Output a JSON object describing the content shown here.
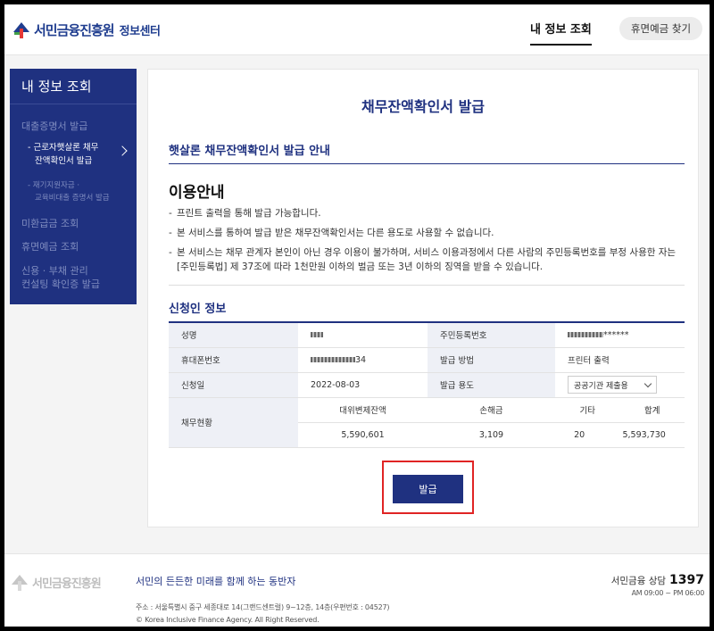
{
  "header": {
    "logo_text": "서민금융진흥원",
    "logo_sub": "정보센터",
    "nav_active": "내 정보 조회",
    "dormant_button": "휴면예금 찾기"
  },
  "sidebar": {
    "title": "내 정보 조회",
    "items": [
      {
        "label": "대출증명서 발급"
      },
      {
        "label": "미환급금 조회"
      },
      {
        "label": "휴면예금 조회"
      },
      {
        "label": "신용 · 부채 관리"
      },
      {
        "label": "컨설팅 확인증 발급"
      }
    ],
    "sub_active_1": "- 근로자햇살론 채무",
    "sub_active_2": "잔액확인서 발급",
    "sub_2_1": "- 재기지원자금 ·",
    "sub_2_2": "교육비대출 증명서 발급"
  },
  "main": {
    "page_title": "채무잔액확인서 발급",
    "section_title": "햇살론 채무잔액확인서 발급 안내",
    "info_heading": "이용안내",
    "bullets": [
      "프린트 출력을 통해 발급 가능합니다.",
      "본 서비스를 통하여 발급 받은 채무잔액확인서는 다른 용도로 사용할 수 없습니다.",
      "본 서비스는 채무 관계자 본인이 아닌 경우 이용이 불가하며, 서비스 이용과정에서 다른 사람의 주민등록번호를 부정 사용한 자는 [주민등록법] 제 37조에 따라 1천만원 이하의 벌금 또는 3년 이하의 징역을 받을 수 있습니다."
    ],
    "applicant_title": "신청인 정보",
    "labels": {
      "name": "성명",
      "rrn": "주민등록번호",
      "phone": "휴대폰번호",
      "method": "발급 방법",
      "date": "신청일",
      "purpose": "발급 용도",
      "debt": "채무현황"
    },
    "values": {
      "rrn_tail": "******",
      "phone_tail": "34",
      "method": "프린터 출력",
      "date": "2022-08-03",
      "purpose": "공공기관 제출용"
    },
    "debt": {
      "headers": [
        "대위변제잔액",
        "손해금",
        "기타",
        "합계"
      ],
      "values": [
        "5,590,601",
        "3,109",
        "20",
        "5,593,730"
      ]
    },
    "issue_button": "발급"
  },
  "footer": {
    "logo_text": "서민금융진흥원",
    "slogan": "서민의 든든한 미래를 함께 하는 동반자",
    "address": "주소 : 서울특별시 중구 세종대로 14(그랜드센트럴) 9~12층, 14층(우편번호 : 04527)",
    "copyright": "© Korea Inclusive Finance Agency. All Right Reserved.",
    "call_label": "서민금융 상담",
    "call_number": "1397",
    "hours": "AM 09:00 ~ PM 06:00"
  },
  "colors": {
    "navy": "#1f3180",
    "highlight_red": "#e02424"
  }
}
